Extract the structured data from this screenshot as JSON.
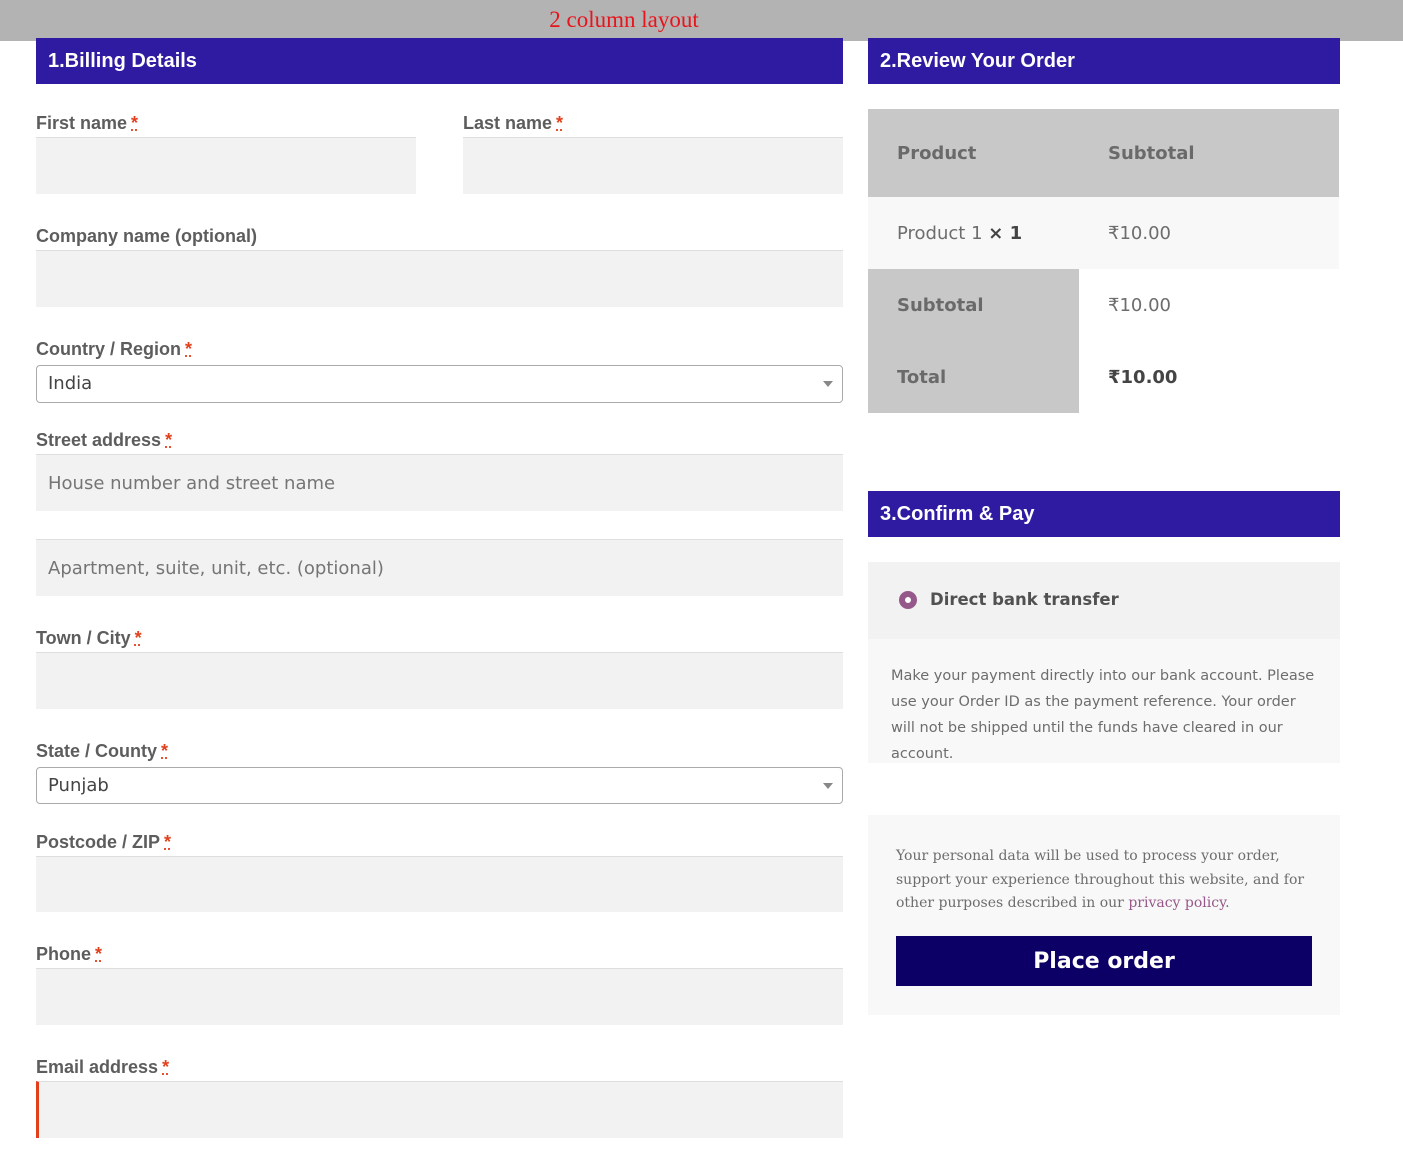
{
  "banner": {
    "title": "2 column layout"
  },
  "billing": {
    "heading": "1.Billing Details",
    "required_marker": "*",
    "first_name_label": "First name",
    "last_name_label": "Last name",
    "company_label": "Company name (optional)",
    "country_label": "Country / Region",
    "country_value": "India",
    "street_label": "Street address",
    "street_placeholder": "House number and street name",
    "street2_placeholder": "Apartment, suite, unit, etc. (optional)",
    "city_label": "Town / City",
    "state_label": "State / County",
    "state_value": "Punjab",
    "postcode_label": "Postcode / ZIP",
    "phone_label": "Phone",
    "email_label": "Email address"
  },
  "review": {
    "heading": "2.Review Your Order",
    "col_product": "Product",
    "col_subtotal": "Subtotal",
    "item_name": "Product 1",
    "item_qty": "× 1",
    "item_price": "₹10.00",
    "subtotal_label": "Subtotal",
    "subtotal_value": "₹10.00",
    "total_label": "Total",
    "total_value": "₹10.00"
  },
  "payment": {
    "heading": "3.Confirm & Pay",
    "method": "Direct bank transfer",
    "description": "Make your payment directly into our bank account. Please use your Order ID as the payment reference. Your order will not be shipped until the funds have cleared in our account.",
    "privacy_text": "Your personal data will be used to process your order, support your experience throughout this website, and for other purposes described in our",
    "privacy_link": "privacy policy",
    "privacy_end": ".",
    "place_order": "Place order"
  },
  "colors": {
    "header_bg": "#2e1ba2",
    "button_bg": "#0c0066",
    "required": "#e2401c",
    "banner_text": "#e8141c",
    "radio": "#96588a"
  }
}
